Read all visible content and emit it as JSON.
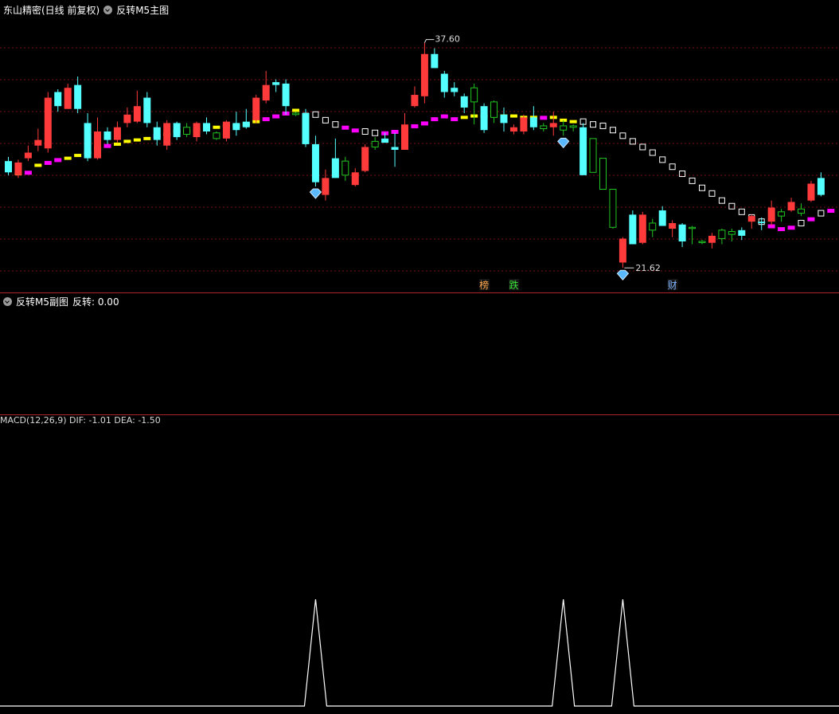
{
  "main_header": {
    "stock_label": "东山精密(日线 前复权)",
    "indicator_label": "反转M5主图"
  },
  "sub_header": {
    "indicator_label": "反转M5副图",
    "value_text": "反转: 0.00"
  },
  "bottom_strip_text": "MACD(12,26,9) DIF: -1.01 DEA: -1.50",
  "colors": {
    "up": "#ff3a3a",
    "down": "#54ffff",
    "ma_up": "#ff00ff",
    "ma_flat": "#ffff00",
    "ma_down": "#ffffff",
    "grid": "#7a1016",
    "marker_bull": "#ffa54a",
    "marker_bear": "#39e639",
    "marker_cai": "#7fb3ff",
    "hollow_green": "#21c521",
    "signal_line": "#ffffff"
  },
  "chart_data": [
    {
      "type": "candlestick",
      "title": "反转M5主图",
      "y_range": [
        20.5,
        39.5
      ],
      "high_label": "37.60",
      "low_label": "21.62",
      "candles": [
        {
          "o": 28.4,
          "c": 29.2,
          "h": 29.5,
          "l": 28.2,
          "t": "d"
        },
        {
          "o": 28.2,
          "c": 29.1,
          "h": 29.3,
          "l": 28.0,
          "t": "u"
        },
        {
          "o": 29.4,
          "c": 29.8,
          "h": 30.3,
          "l": 29.2,
          "t": "u"
        },
        {
          "o": 30.3,
          "c": 30.7,
          "h": 31.5,
          "l": 29.9,
          "t": "u"
        },
        {
          "o": 30.1,
          "c": 33.7,
          "h": 34.1,
          "l": 29.8,
          "t": "u"
        },
        {
          "o": 34.1,
          "c": 33.1,
          "h": 34.3,
          "l": 32.7,
          "t": "d"
        },
        {
          "o": 32.9,
          "c": 34.4,
          "h": 34.7,
          "l": 32.9,
          "t": "u"
        },
        {
          "o": 34.6,
          "c": 32.9,
          "h": 35.2,
          "l": 32.6,
          "t": "d"
        },
        {
          "o": 31.9,
          "c": 29.4,
          "h": 32.6,
          "l": 29.2,
          "t": "d"
        },
        {
          "o": 29.4,
          "c": 31.3,
          "h": 32.3,
          "l": 29.3,
          "t": "u"
        },
        {
          "o": 31.3,
          "c": 30.7,
          "h": 31.6,
          "l": 30.4,
          "t": "d"
        },
        {
          "o": 30.7,
          "c": 31.6,
          "h": 32.0,
          "l": 30.5,
          "t": "u"
        },
        {
          "o": 32.5,
          "c": 31.9,
          "h": 33.0,
          "l": 31.6,
          "t": "u"
        },
        {
          "o": 32.0,
          "c": 33.1,
          "h": 34.2,
          "l": 31.9,
          "t": "u"
        },
        {
          "o": 33.7,
          "c": 31.9,
          "h": 34.1,
          "l": 31.6,
          "t": "d"
        },
        {
          "o": 31.6,
          "c": 30.7,
          "h": 32.0,
          "l": 30.3,
          "t": "d"
        },
        {
          "o": 30.3,
          "c": 31.9,
          "h": 32.1,
          "l": 30.0,
          "t": "u"
        },
        {
          "o": 31.9,
          "c": 30.9,
          "h": 32.0,
          "l": 30.7,
          "t": "d"
        },
        {
          "o": 31.6,
          "c": 31.1,
          "h": 31.9,
          "l": 30.9,
          "t": "h"
        },
        {
          "o": 30.9,
          "c": 31.9,
          "h": 32.0,
          "l": 30.6,
          "t": "u"
        },
        {
          "o": 31.3,
          "c": 31.9,
          "h": 32.3,
          "l": 31.1,
          "t": "d"
        },
        {
          "o": 31.2,
          "c": 30.8,
          "h": 31.3,
          "l": 30.7,
          "t": "h"
        },
        {
          "o": 30.8,
          "c": 32.0,
          "h": 32.1,
          "l": 30.6,
          "t": "u"
        },
        {
          "o": 31.4,
          "c": 31.9,
          "h": 32.7,
          "l": 31.0,
          "t": "d"
        },
        {
          "o": 31.6,
          "c": 32.0,
          "h": 32.9,
          "l": 31.5,
          "t": "d"
        },
        {
          "o": 32.1,
          "c": 33.7,
          "h": 33.9,
          "l": 31.9,
          "t": "u"
        },
        {
          "o": 33.5,
          "c": 34.6,
          "h": 35.6,
          "l": 33.3,
          "t": "u"
        },
        {
          "o": 34.6,
          "c": 34.8,
          "h": 35.0,
          "l": 34.1,
          "t": "d"
        },
        {
          "o": 34.7,
          "c": 33.1,
          "h": 35.0,
          "l": 32.5,
          "t": "d"
        },
        {
          "o": 32.5,
          "c": 32.6,
          "h": 32.7,
          "l": 32.4,
          "t": "h"
        },
        {
          "o": 32.6,
          "c": 30.4,
          "h": 32.9,
          "l": 30.2,
          "t": "d"
        },
        {
          "o": 30.4,
          "c": 27.7,
          "h": 31.0,
          "l": 27.4,
          "t": "d"
        },
        {
          "o": 26.8,
          "c": 28.0,
          "h": 28.6,
          "l": 26.4,
          "t": "u"
        },
        {
          "o": 29.4,
          "c": 28.0,
          "h": 30.8,
          "l": 28.0,
          "t": "d"
        },
        {
          "o": 28.2,
          "c": 29.2,
          "h": 29.5,
          "l": 27.8,
          "t": "h"
        },
        {
          "o": 27.5,
          "c": 28.4,
          "h": 28.7,
          "l": 27.4,
          "t": "u"
        },
        {
          "o": 28.5,
          "c": 30.2,
          "h": 30.4,
          "l": 28.4,
          "t": "u"
        },
        {
          "o": 30.2,
          "c": 30.6,
          "h": 30.9,
          "l": 30.0,
          "t": "h"
        },
        {
          "o": 30.8,
          "c": 30.5,
          "h": 31.2,
          "l": 30.5,
          "t": "d"
        },
        {
          "o": 30.0,
          "c": 30.2,
          "h": 31.2,
          "l": 28.8,
          "t": "d"
        },
        {
          "o": 30.0,
          "c": 31.8,
          "h": 32.6,
          "l": 30.0,
          "t": "u"
        },
        {
          "o": 33.1,
          "c": 33.9,
          "h": 34.5,
          "l": 33.0,
          "t": "u"
        },
        {
          "o": 33.8,
          "c": 36.8,
          "h": 37.6,
          "l": 33.3,
          "t": "u"
        },
        {
          "o": 36.8,
          "c": 35.8,
          "h": 37.2,
          "l": 35.8,
          "t": "d"
        },
        {
          "o": 35.4,
          "c": 34.1,
          "h": 35.6,
          "l": 33.7,
          "t": "d"
        },
        {
          "o": 34.1,
          "c": 34.4,
          "h": 34.8,
          "l": 33.8,
          "t": "d"
        },
        {
          "o": 33.8,
          "c": 33.0,
          "h": 34.0,
          "l": 32.6,
          "t": "d"
        },
        {
          "o": 33.4,
          "c": 34.4,
          "h": 34.7,
          "l": 31.8,
          "t": "h"
        },
        {
          "o": 33.1,
          "c": 31.4,
          "h": 33.3,
          "l": 31.2,
          "t": "d"
        },
        {
          "o": 32.3,
          "c": 33.4,
          "h": 33.5,
          "l": 31.9,
          "t": "h"
        },
        {
          "o": 32.5,
          "c": 31.9,
          "h": 33.0,
          "l": 31.3,
          "t": "d"
        },
        {
          "o": 31.3,
          "c": 31.6,
          "h": 31.8,
          "l": 31.1,
          "t": "u"
        },
        {
          "o": 31.3,
          "c": 32.3,
          "h": 32.5,
          "l": 31.1,
          "t": "u"
        },
        {
          "o": 32.3,
          "c": 31.6,
          "h": 33.1,
          "l": 31.4,
          "t": "d"
        },
        {
          "o": 31.5,
          "c": 31.7,
          "h": 31.9,
          "l": 31.3,
          "t": "h"
        },
        {
          "o": 31.6,
          "c": 31.9,
          "h": 32.7,
          "l": 31.0,
          "t": "u"
        },
        {
          "o": 31.4,
          "c": 31.7,
          "h": 32.1,
          "l": 31.0,
          "t": "h"
        },
        {
          "o": 31.7,
          "c": 31.6,
          "h": 31.8,
          "l": 31.3,
          "t": "h"
        },
        {
          "o": 31.6,
          "c": 28.2,
          "h": 31.9,
          "l": 28.2,
          "t": "d"
        },
        {
          "o": 30.8,
          "c": 28.4,
          "h": 30.8,
          "l": 28.4,
          "t": "h"
        },
        {
          "o": 29.4,
          "c": 27.2,
          "h": 29.4,
          "l": 27.2,
          "t": "h"
        },
        {
          "o": 27.2,
          "c": 24.5,
          "h": 27.2,
          "l": 24.4,
          "t": "h"
        },
        {
          "o": 22.0,
          "c": 23.7,
          "h": 23.8,
          "l": 21.62,
          "t": "u"
        },
        {
          "o": 25.4,
          "c": 23.3,
          "h": 25.7,
          "l": 23.3,
          "t": "d"
        },
        {
          "o": 23.4,
          "c": 25.4,
          "h": 25.6,
          "l": 23.3,
          "t": "u"
        },
        {
          "o": 24.8,
          "c": 24.3,
          "h": 25.1,
          "l": 23.8,
          "t": "h"
        },
        {
          "o": 25.7,
          "c": 24.6,
          "h": 26.0,
          "l": 24.6,
          "t": "d"
        },
        {
          "o": 24.4,
          "c": 24.8,
          "h": 25.0,
          "l": 23.8,
          "t": "u"
        },
        {
          "o": 24.7,
          "c": 23.5,
          "h": 24.8,
          "l": 23.1,
          "t": "d"
        },
        {
          "o": 24.5,
          "c": 24.5,
          "h": 24.6,
          "l": 23.3,
          "t": "h"
        },
        {
          "o": 23.5,
          "c": 23.5,
          "h": 23.6,
          "l": 23.3,
          "t": "h"
        },
        {
          "o": 23.4,
          "c": 23.9,
          "h": 24.1,
          "l": 23.0,
          "t": "u"
        },
        {
          "o": 23.7,
          "c": 24.3,
          "h": 24.4,
          "l": 23.3,
          "t": "h"
        },
        {
          "o": 24.0,
          "c": 24.2,
          "h": 24.4,
          "l": 23.5,
          "t": "h"
        },
        {
          "o": 24.3,
          "c": 23.9,
          "h": 24.5,
          "l": 23.6,
          "t": "d"
        },
        {
          "o": 24.9,
          "c": 25.3,
          "h": 25.4,
          "l": 24.4,
          "t": "u"
        },
        {
          "o": 24.8,
          "c": 24.9,
          "h": 25.2,
          "l": 24.3,
          "t": "d"
        },
        {
          "o": 24.9,
          "c": 25.9,
          "h": 26.4,
          "l": 24.6,
          "t": "u"
        },
        {
          "o": 25.6,
          "c": 25.3,
          "h": 25.8,
          "l": 24.9,
          "t": "h"
        },
        {
          "o": 25.7,
          "c": 26.3,
          "h": 26.6,
          "l": 25.6,
          "t": "u"
        },
        {
          "o": 25.8,
          "c": 25.5,
          "h": 26.2,
          "l": 25.3,
          "t": "h"
        },
        {
          "o": 26.4,
          "c": 27.6,
          "h": 27.8,
          "l": 26.3,
          "t": "u"
        },
        {
          "o": 28.0,
          "c": 26.8,
          "h": 28.4,
          "l": 26.7,
          "t": "d"
        }
      ],
      "ma": [
        28.7,
        28.3,
        28.4,
        28.9,
        29.1,
        29.3,
        29.4,
        29.6,
        29.8,
        30.1,
        30.3,
        30.4,
        30.6,
        30.7,
        30.8,
        31.0,
        31.1,
        31.3,
        31.3,
        31.4,
        31.5,
        31.6,
        31.7,
        31.7,
        31.8,
        32.0,
        32.2,
        32.4,
        32.6,
        32.8,
        32.4,
        32.5,
        32.1,
        31.8,
        31.6,
        31.4,
        31.3,
        31.2,
        31.2,
        31.3,
        31.5,
        31.7,
        31.9,
        32.2,
        32.4,
        32.2,
        32.3,
        32.4,
        32.4,
        32.4,
        32.4,
        32.4,
        32.3,
        32.3,
        32.3,
        32.3,
        32.1,
        32.0,
        32.0,
        31.8,
        31.7,
        31.4,
        31.0,
        30.6,
        30.2,
        29.8,
        29.3,
        28.8,
        28.3,
        27.8,
        27.3,
        26.9,
        26.4,
        26.0,
        25.6,
        25.2,
        24.9,
        24.6,
        24.4,
        24.5,
        24.8,
        25.1,
        25.5,
        25.7
      ],
      "ma_state": [
        "y",
        "y",
        "m",
        "y",
        "m",
        "m",
        "y",
        "y",
        "y",
        "y",
        "m",
        "y",
        "y",
        "y",
        "y",
        "m",
        "y",
        "y",
        "y",
        "y",
        "y",
        "y",
        "y",
        "y",
        "y",
        "y",
        "m",
        "m",
        "m",
        "y",
        "w",
        "w",
        "w",
        "w",
        "m",
        "m",
        "w",
        "w",
        "m",
        "m",
        "m",
        "m",
        "m",
        "m",
        "m",
        "m",
        "y",
        "y",
        "y",
        "y",
        "y",
        "y",
        "y",
        "y",
        "m",
        "y",
        "y",
        "y",
        "w",
        "w",
        "w",
        "w",
        "w",
        "w",
        "w",
        "w",
        "w",
        "w",
        "w",
        "w",
        "w",
        "w",
        "w",
        "w",
        "w",
        "w",
        "w",
        "m",
        "m",
        "m",
        "w",
        "m",
        "w",
        "m",
        "w"
      ],
      "markers": [
        {
          "idx": 31,
          "kind": "diamond"
        },
        {
          "idx": 56,
          "kind": "diamond"
        },
        {
          "idx": 62,
          "kind": "diamond"
        },
        {
          "idx": 48,
          "kind": "text",
          "label": "榜",
          "color": "#ffa54a"
        },
        {
          "idx": 51,
          "kind": "text",
          "label": "跌",
          "color": "#39e639"
        },
        {
          "idx": 67,
          "kind": "text",
          "label": "财",
          "color": "#7fb3ff"
        }
      ]
    },
    {
      "type": "line",
      "title": "反转M5副图",
      "series": [
        {
          "name": "反转",
          "values": [
            0,
            0,
            0,
            0,
            0,
            0,
            0,
            0,
            0,
            0,
            0,
            0,
            0,
            0,
            0,
            0,
            0,
            0,
            0,
            0,
            0,
            0,
            0,
            0,
            0,
            0,
            0,
            0,
            0,
            0,
            0,
            1,
            0,
            0,
            0,
            0,
            0,
            0,
            0,
            0,
            0,
            0,
            0,
            0,
            0,
            0,
            0,
            0,
            0,
            0,
            0,
            0,
            0,
            0,
            0,
            0,
            1,
            0,
            0,
            0,
            0,
            0,
            1,
            0,
            0,
            0,
            0,
            0,
            0,
            0,
            0,
            0,
            0,
            0,
            0,
            0,
            0,
            0,
            0,
            0,
            0,
            0,
            0,
            0
          ]
        }
      ],
      "ylim": [
        0,
        1
      ]
    }
  ]
}
